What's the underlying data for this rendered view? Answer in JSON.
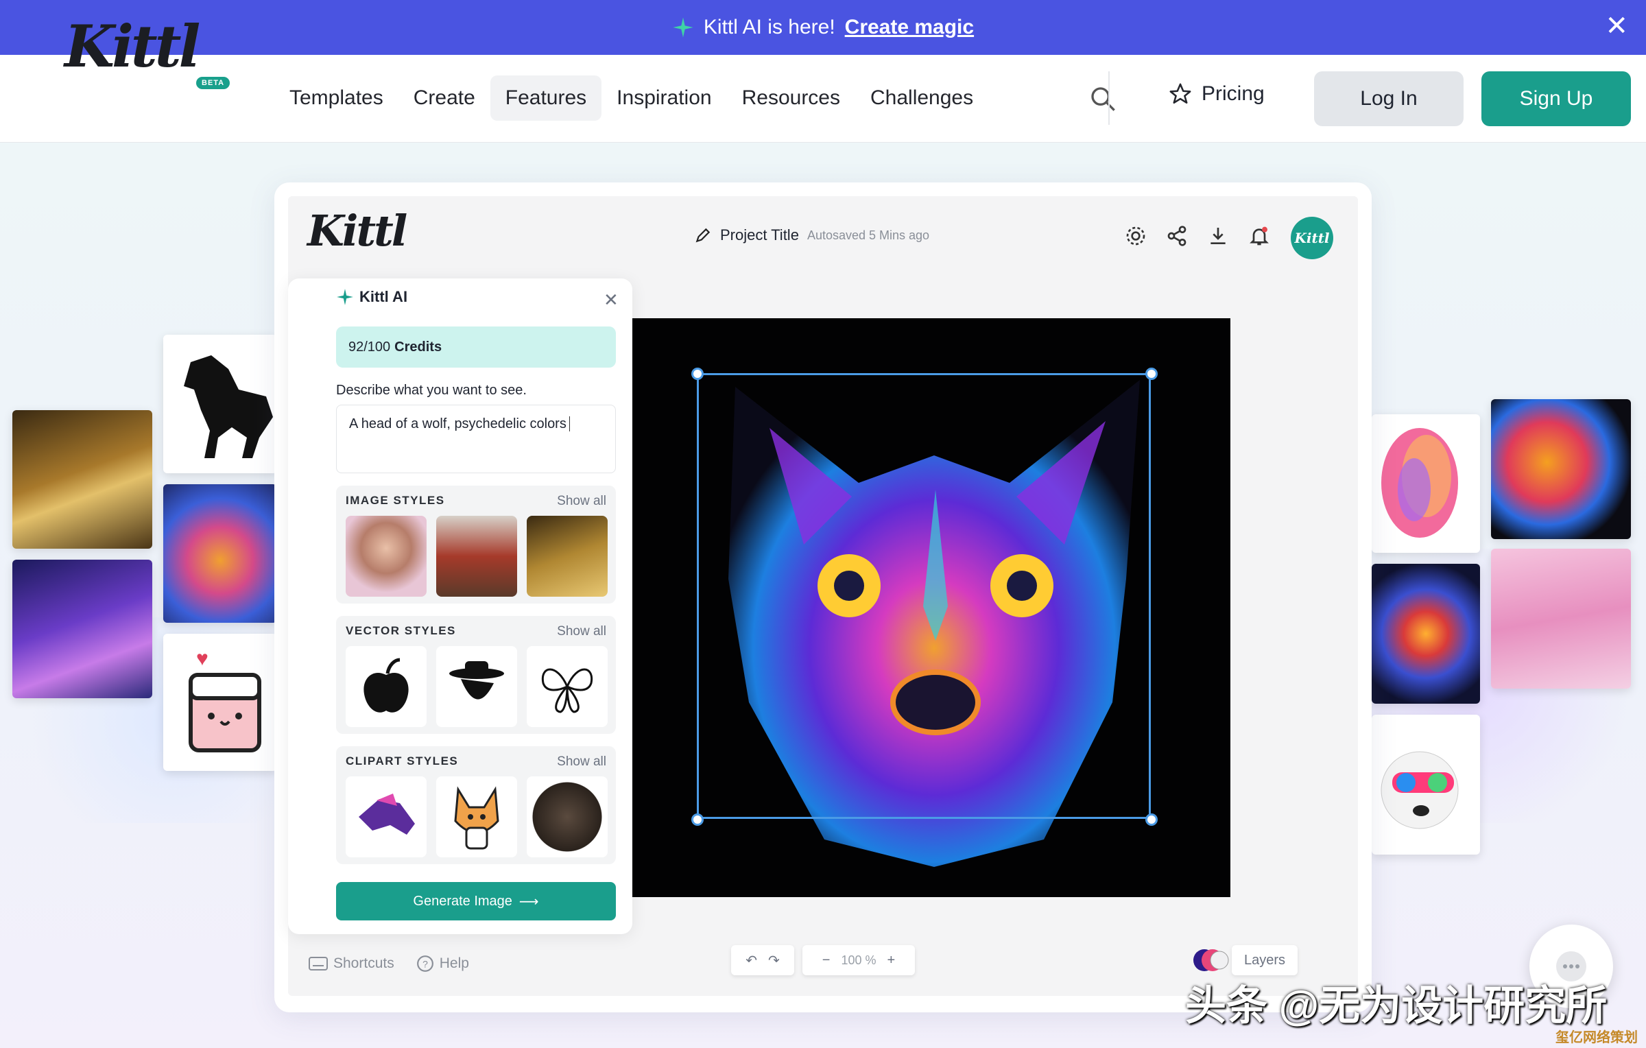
{
  "banner": {
    "text": "Kittl AI is here!",
    "link": "Create magic"
  },
  "nav": {
    "logo": "Kittl",
    "beta": "BETA",
    "items": [
      "Templates",
      "Create",
      "Features",
      "Inspiration",
      "Resources",
      "Challenges"
    ],
    "active": "Features",
    "pricing": "Pricing",
    "login": "Log In",
    "signup": "Sign Up"
  },
  "editor": {
    "logo": "Kittl",
    "project_title": "Project Title",
    "autosaved": "Autosaved 5 Mins ago",
    "avatar_text": "Kittl",
    "shortcuts": "Shortcuts",
    "help": "Help",
    "zoom": "100 %",
    "layers": "Layers"
  },
  "ai_panel": {
    "title": "Kittl AI",
    "credits_value": "92/100",
    "credits_label": "Credits",
    "describe_label": "Describe what you want to see.",
    "prompt": "A head of a wolf, psychedelic colors",
    "sections": [
      {
        "title": "IMAGE STYLES",
        "show_all": "Show all"
      },
      {
        "title": "VECTOR STYLES",
        "show_all": "Show all"
      },
      {
        "title": "CLIPART STYLES",
        "show_all": "Show all"
      }
    ],
    "generate": "Generate Image"
  },
  "watermark": {
    "text": "头条 @无为设计研究所",
    "corner": "玺亿网络策划"
  },
  "colors": {
    "banner": "#4a54e1",
    "brand": "#1a9e8c",
    "selection": "#4b9be6"
  }
}
